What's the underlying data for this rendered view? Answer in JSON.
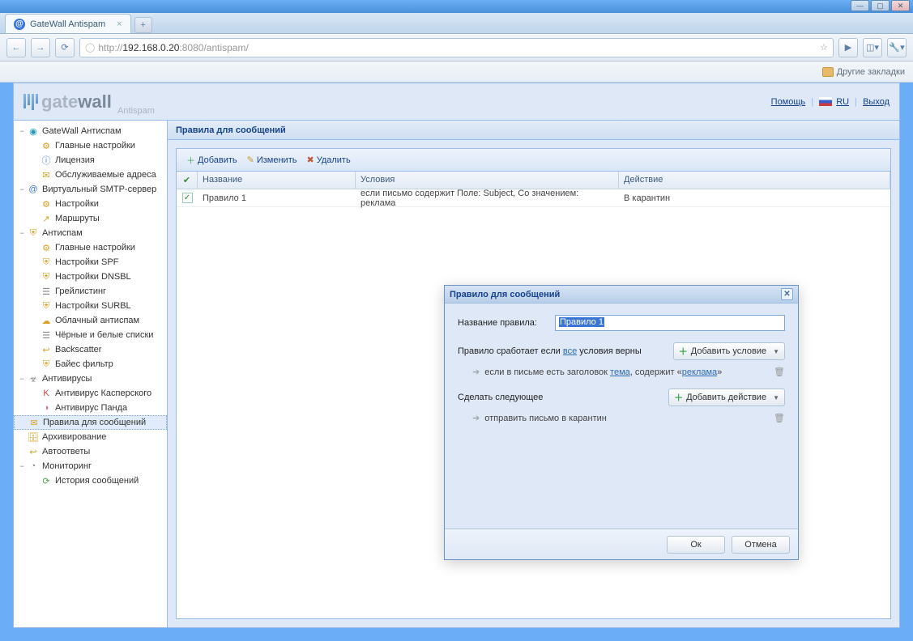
{
  "browser": {
    "tab_title": "GateWall Antispam",
    "url_prefix": "http://",
    "url_host": "192.168.0.20",
    "url_port": ":8080",
    "url_path": "/antispam/",
    "bookmarks_link": "Другие закладки"
  },
  "header": {
    "logo1": "gate",
    "logo2": "wall",
    "logo_sub": "Antispam",
    "help": "Помощь",
    "lang": "RU",
    "logout": "Выход"
  },
  "sidebar": {
    "items": [
      {
        "label": "GateWall Антиспам",
        "indent": 0,
        "toggle": "−",
        "icon": "◉",
        "cls": "ic-cyan"
      },
      {
        "label": "Главные настройки",
        "indent": 1,
        "icon": "⚙",
        "cls": "ic-yellow"
      },
      {
        "label": "Лицензия",
        "indent": 1,
        "icon": "ⓘ",
        "cls": "ic-blue"
      },
      {
        "label": "Обслуживаемые адреса",
        "indent": 1,
        "icon": "✉",
        "cls": "ic-yellow"
      },
      {
        "label": "Виртуальный SMTP-сервер",
        "indent": 0,
        "toggle": "−",
        "icon": "@",
        "cls": "ic-blue"
      },
      {
        "label": "Настройки",
        "indent": 1,
        "icon": "⚙",
        "cls": "ic-yellow"
      },
      {
        "label": "Маршруты",
        "indent": 1,
        "icon": "↗",
        "cls": "ic-yellow"
      },
      {
        "label": "Антиспам",
        "indent": 0,
        "toggle": "−",
        "icon": "⛨",
        "cls": "ic-yellow"
      },
      {
        "label": "Главные настройки",
        "indent": 1,
        "icon": "⚙",
        "cls": "ic-yellow"
      },
      {
        "label": "Настройки SPF",
        "indent": 1,
        "icon": "⛨",
        "cls": "ic-yellow"
      },
      {
        "label": "Настройки DNSBL",
        "indent": 1,
        "icon": "⛨",
        "cls": "ic-yellow"
      },
      {
        "label": "Грейлистинг",
        "indent": 1,
        "icon": "☰",
        "cls": "ic-gray"
      },
      {
        "label": "Настройки SURBL",
        "indent": 1,
        "icon": "⛨",
        "cls": "ic-yellow"
      },
      {
        "label": "Облачный антиспам",
        "indent": 1,
        "icon": "☁",
        "cls": "ic-yellow"
      },
      {
        "label": "Чёрные и белые списки",
        "indent": 1,
        "icon": "☰",
        "cls": "ic-gray"
      },
      {
        "label": "Backscatter",
        "indent": 1,
        "icon": "↩",
        "cls": "ic-yellow"
      },
      {
        "label": "Байес фильтр",
        "indent": 1,
        "icon": "⛨",
        "cls": "ic-yellow"
      },
      {
        "label": "Антивирусы",
        "indent": 0,
        "toggle": "−",
        "icon": "☣",
        "cls": "ic-gray"
      },
      {
        "label": "Антивирус Касперского",
        "indent": 1,
        "icon": "K",
        "cls": "ic-red"
      },
      {
        "label": "Антивирус Панда",
        "indent": 1,
        "icon": "◑",
        "cls": "ic-pink"
      },
      {
        "label": "Правила для сообщений",
        "indent": 0,
        "icon": "✉",
        "cls": "ic-yellow",
        "selected": true
      },
      {
        "label": "Архивирование",
        "indent": 0,
        "icon": "🗄",
        "cls": "ic-yellow"
      },
      {
        "label": "Автоответы",
        "indent": 0,
        "icon": "↩",
        "cls": "ic-yellow"
      },
      {
        "label": "Мониторинг",
        "indent": 0,
        "toggle": "−",
        "icon": "◔",
        "cls": "ic-gray"
      },
      {
        "label": "История сообщений",
        "indent": 1,
        "icon": "⟳",
        "cls": "ic-green"
      }
    ]
  },
  "main": {
    "title": "Правила для сообщений",
    "toolbar": {
      "add": "Добавить",
      "edit": "Изменить",
      "del": "Удалить"
    },
    "columns": {
      "name": "Название",
      "condition": "Условия",
      "action": "Действие"
    },
    "row": {
      "name": "Правило 1",
      "condition": "если письмо содержит Поле: Subject, Со значением: реклама",
      "action": "В карантин"
    }
  },
  "modal": {
    "title": "Правило для сообщений",
    "name_label": "Название правила:",
    "name_value": "Правило 1",
    "cond_prefix": "Правило сработает если ",
    "cond_link": "все",
    "cond_suffix": " условия верны",
    "add_condition": "Добавить условие",
    "cond_text1": "если в письме есть заголовок ",
    "cond_link1": "тема",
    "cond_text2": ", содержит «",
    "cond_link2": "реклама",
    "cond_text3": "»",
    "action_label": "Сделать следующее",
    "add_action": "Добавить действие",
    "action_text": "отправить письмо в карантин",
    "ok": "Ок",
    "cancel": "Отмена"
  }
}
